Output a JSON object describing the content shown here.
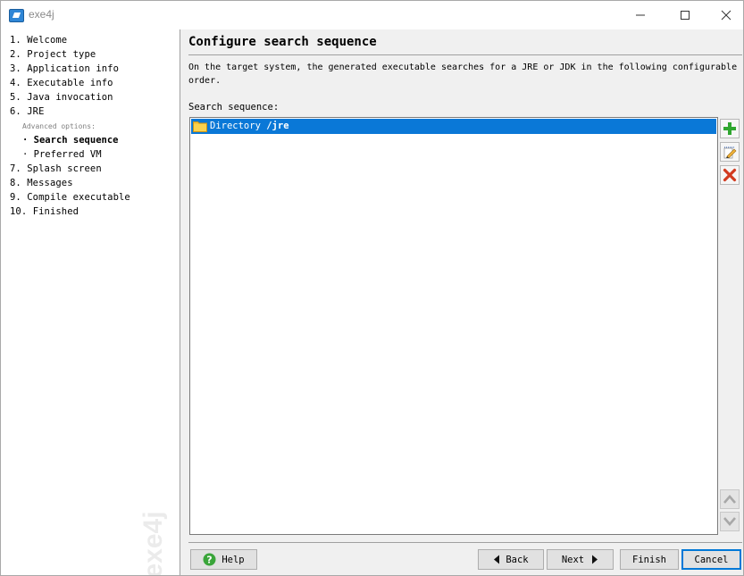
{
  "window": {
    "title": "exe4j",
    "app_icon": "exe4j-app-icon",
    "controls": {
      "minimize_icon": "minimize-icon",
      "maximize_icon": "maximize-icon",
      "close_icon": "close-icon"
    }
  },
  "sidebar": {
    "steps": [
      {
        "num": "1.",
        "label": "Welcome"
      },
      {
        "num": "2.",
        "label": "Project type"
      },
      {
        "num": "3.",
        "label": "Application info"
      },
      {
        "num": "4.",
        "label": "Executable info"
      },
      {
        "num": "5.",
        "label": "Java invocation"
      },
      {
        "num": "6.",
        "label": "JRE"
      }
    ],
    "advanced_label": "Advanced options:",
    "sub_items": [
      {
        "label": "Search sequence",
        "active": true
      },
      {
        "label": "Preferred VM",
        "active": false
      }
    ],
    "steps_after": [
      {
        "num": "7.",
        "label": "Splash screen"
      },
      {
        "num": "8.",
        "label": "Messages"
      },
      {
        "num": "9.",
        "label": "Compile executable"
      },
      {
        "num": "10.",
        "label": "Finished"
      }
    ],
    "watermark": "exe4j"
  },
  "main": {
    "title": "Configure search sequence",
    "description": "On the target system, the generated executable searches for a JRE or JDK in the following configurable order.",
    "sequence_label": "Search sequence:",
    "entries": [
      {
        "type": "Directory",
        "value": "/jre",
        "icon": "folder-icon",
        "selected": true
      }
    ],
    "side_buttons": [
      {
        "name": "add-entry-button",
        "icon": "plus-icon",
        "enabled": true
      },
      {
        "name": "edit-entry-button",
        "icon": "edit-icon",
        "enabled": true
      },
      {
        "name": "remove-entry-button",
        "icon": "delete-icon",
        "enabled": true
      },
      {
        "name": "move-up-button",
        "icon": "arrow-up-icon",
        "enabled": false
      },
      {
        "name": "move-down-button",
        "icon": "arrow-down-icon",
        "enabled": false
      }
    ]
  },
  "footer": {
    "help": "Help",
    "back": "Back",
    "next": "Next",
    "finish": "Finish",
    "cancel": "Cancel"
  },
  "colors": {
    "selection": "#0a78d7",
    "add_green": "#2fa62f",
    "delete_red": "#d23a1f",
    "help_green": "#3aa53a",
    "focus_border": "#0078d7"
  }
}
